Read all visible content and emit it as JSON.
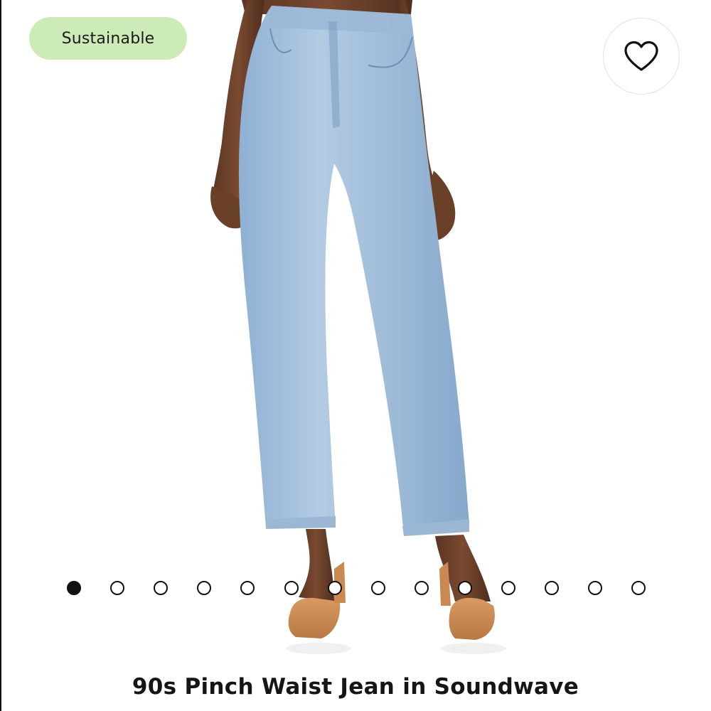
{
  "badge": {
    "label": "Sustainable",
    "color": "#cdebb6"
  },
  "favorite": {
    "icon": "heart-icon"
  },
  "product": {
    "title": "90s Pinch Waist Jean in Soundwave",
    "image": "product-photo"
  },
  "gallery": {
    "count": 14,
    "active_index": 0
  }
}
